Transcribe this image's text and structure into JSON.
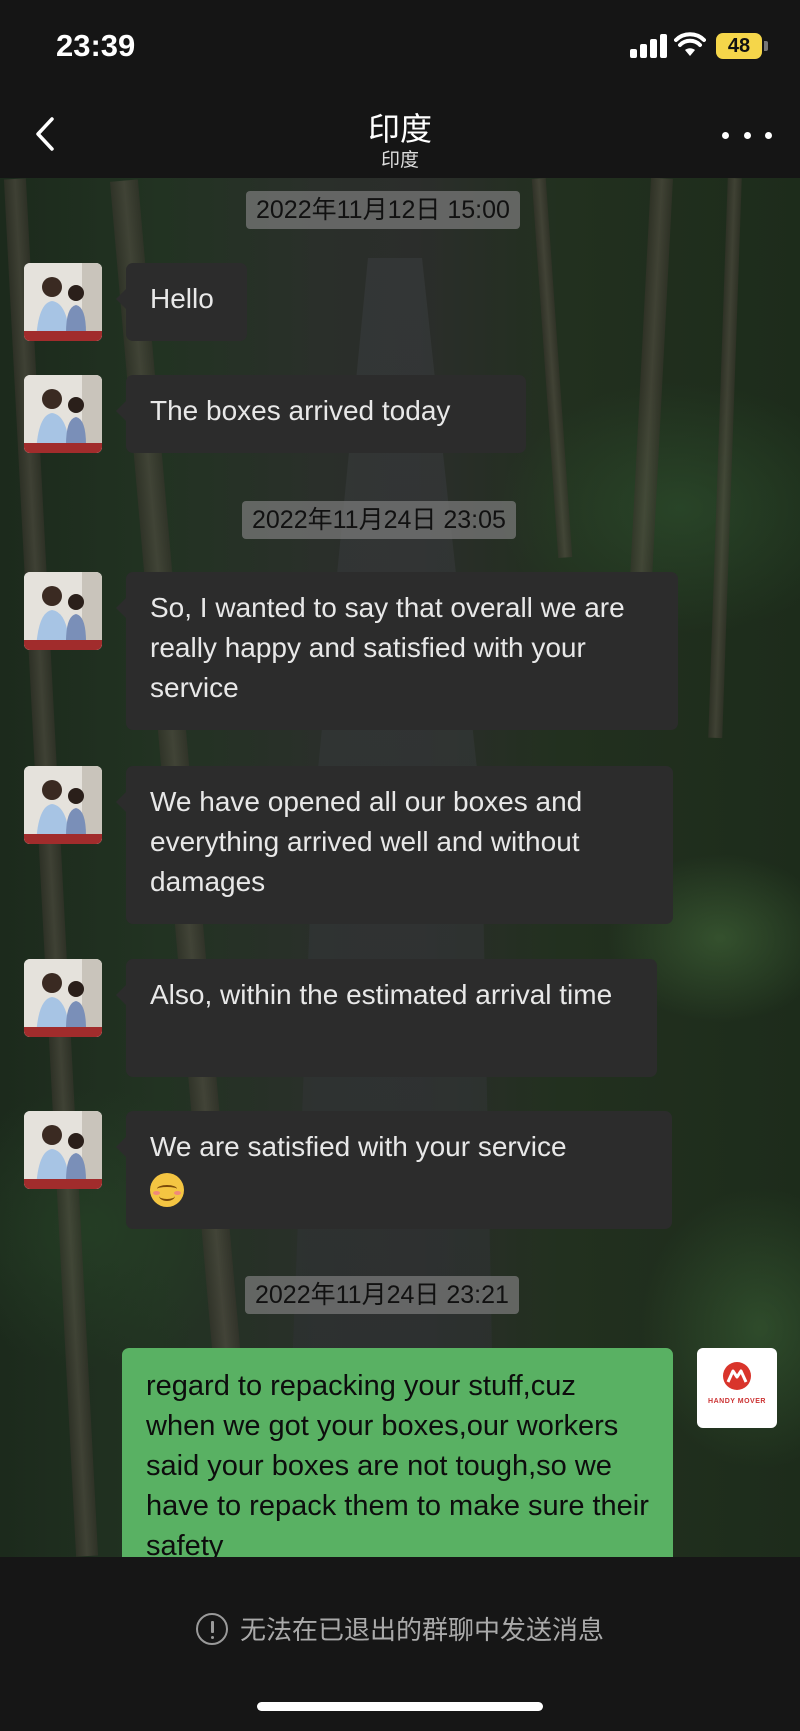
{
  "status_bar": {
    "time": "23:39",
    "battery": "48"
  },
  "header": {
    "title": "印度",
    "subtitle": "印度"
  },
  "messages": {
    "ts1": "2022年11月12日 15:00",
    "m1": "Hello",
    "m2": "The boxes arrived today",
    "ts2": "2022年11月24日 23:05",
    "m3": "So, I wanted to say that overall we are really happy and satisfied with your service",
    "m4": "We have opened all our boxes and  everything arrived well and without damages",
    "m5": "Also, within the estimated arrival time",
    "m6": "We are satisfied with your service",
    "ts3": "2022年11月24日 23:21",
    "m7": "regard to repacking your stuff,cuz when we got your boxes,our workers said your boxes are not tough,so we have to repack them to make sure their safety"
  },
  "own_avatar": {
    "logo_text": "HANDY MOVER",
    "brand_color": "#d9342b"
  },
  "footer": {
    "notice": "无法在已退出的群聊中发送消息"
  },
  "colors": {
    "outgoing_bubble": "#59b163",
    "incoming_bubble": "#2c2c2c",
    "battery": "#f5d64a"
  }
}
